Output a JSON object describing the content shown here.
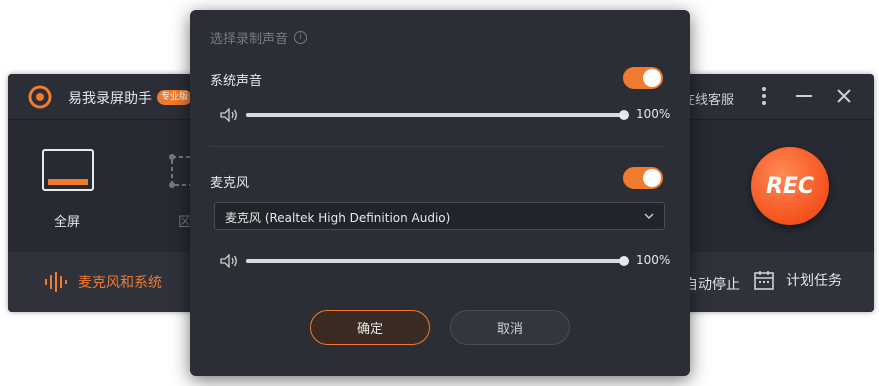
{
  "app": {
    "title": "易我录屏助手",
    "badge": "专业版",
    "support_label": "在线客服",
    "modes": [
      {
        "label": "全屏",
        "icon": "fullscreen-icon"
      },
      {
        "label": "区",
        "icon": "region-icon"
      }
    ],
    "rec_label": "REC",
    "audio_source_label": "麦克风和系统",
    "autostop_label": "自动停止",
    "schedule_label": "计划任务",
    "accent_color": "#f07a2e"
  },
  "dialog": {
    "title": "选择录制声音",
    "system_sound": {
      "label": "系统声音",
      "enabled": true,
      "volume_percent": 100,
      "volume_text": "100%"
    },
    "microphone": {
      "label": "麦克风",
      "enabled": true,
      "device": "麦克风 (Realtek High Definition Audio)",
      "volume_percent": 100,
      "volume_text": "100%"
    },
    "ok_label": "确定",
    "cancel_label": "取消"
  }
}
